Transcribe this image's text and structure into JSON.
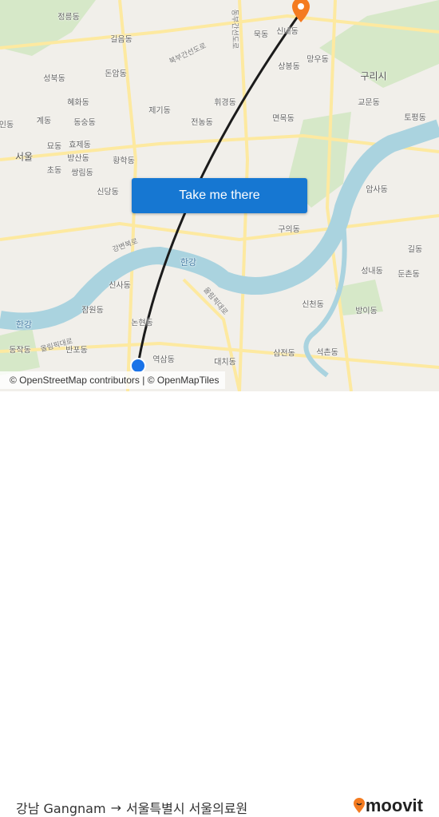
{
  "map": {
    "labels": [
      "정릉동",
      "길음동",
      "성북동",
      "돈암동",
      "혜화동",
      "제기동",
      "휘경동",
      "상봉동",
      "망우동",
      "신내동",
      "묵동",
      "구리시",
      "교문동",
      "토평동",
      "면목동",
      "전농동",
      "동숭동",
      "계동",
      "묘동",
      "효제동",
      "서울",
      "방산동",
      "황학동",
      "초동",
      "쌍림동",
      "신당동",
      "암사동",
      "구의동",
      "길동",
      "성내동",
      "둔촌동",
      "신사동",
      "잠원동",
      "신천동",
      "방이동",
      "논현동",
      "동작동",
      "반포동",
      "역삼동",
      "삼전동",
      "석촌동",
      "대치동",
      "인동",
      "한강",
      "한강",
      "북부간선도로",
      "강변북로",
      "올림픽대로",
      "올림픽대로",
      "동부간선도로"
    ],
    "colors": {
      "water": "#aad3df",
      "road": "#fde9a0",
      "park": "#d6e8c8",
      "route": "#1b1b1b",
      "origin": "#1a73e8",
      "destination": "#f47b20"
    }
  },
  "cta": {
    "label": "Take me there"
  },
  "attribution": "© OpenStreetMap contributors | © OpenMapTiles",
  "footer": {
    "origin": "강남 Gangnam",
    "arrow": "→",
    "destination": "서울특별시 서울의료원",
    "brand": "moovit"
  }
}
